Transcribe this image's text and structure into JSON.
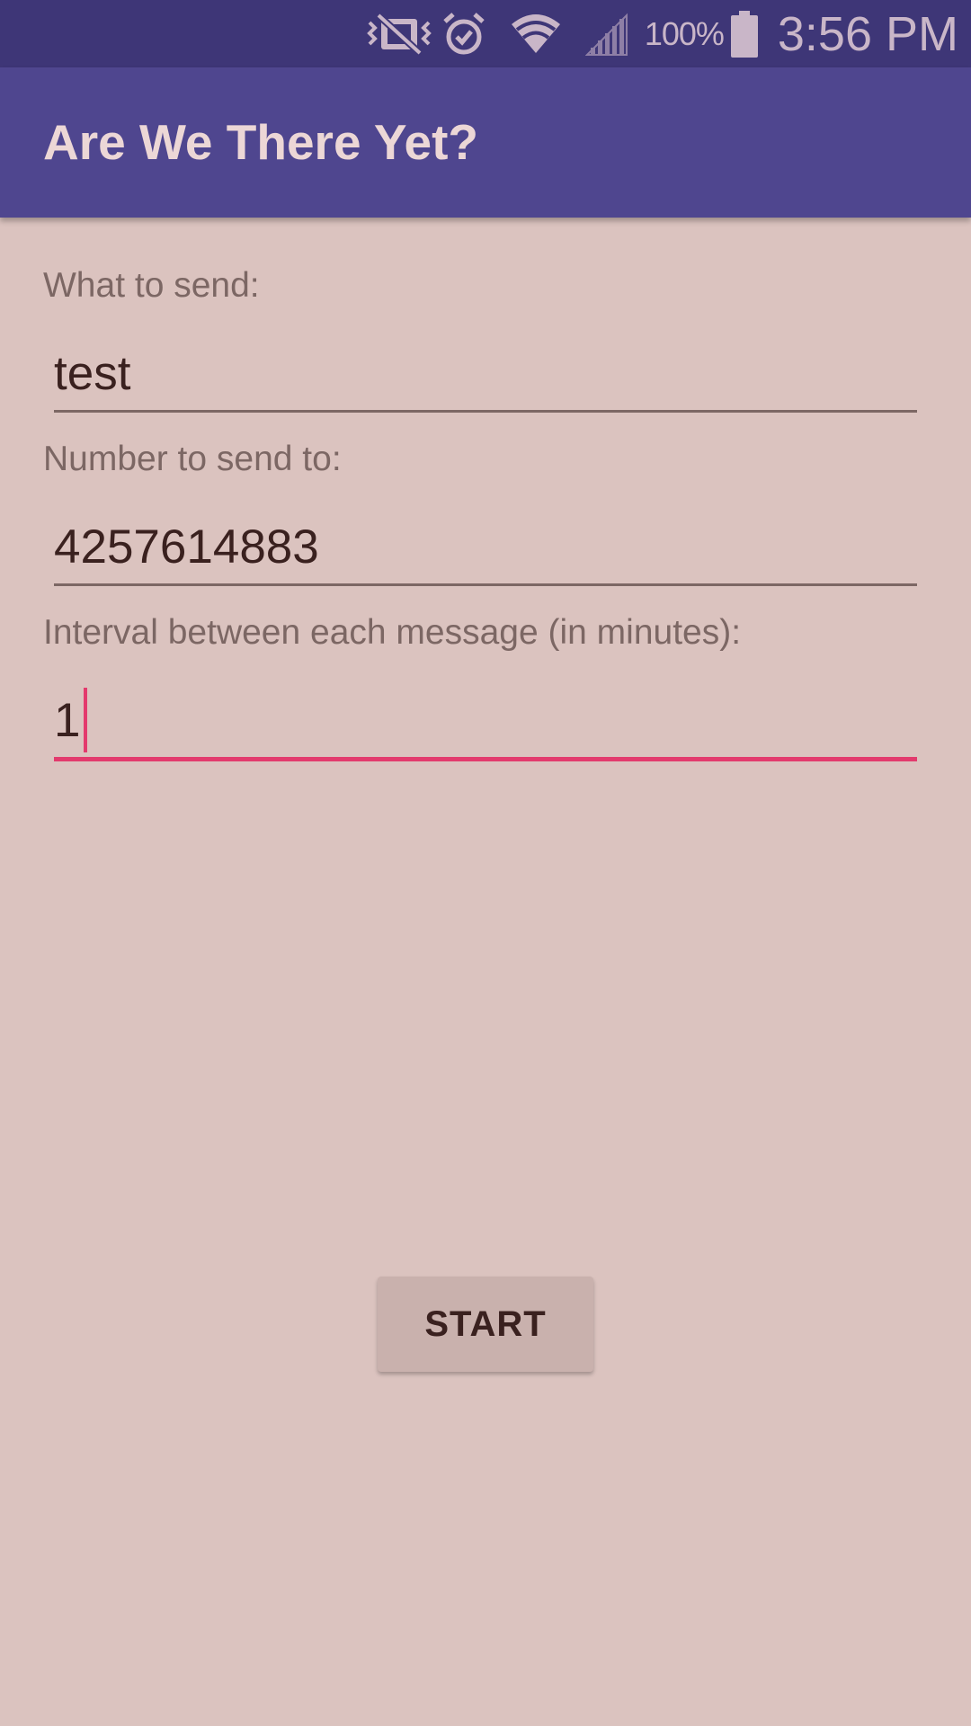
{
  "status_bar": {
    "icons": [
      "vibrate-icon",
      "alarm-icon",
      "wifi-icon",
      "signal-icon",
      "battery-icon"
    ],
    "battery_percent": "100%",
    "time": "3:56 PM"
  },
  "app_bar": {
    "title": "Are We There Yet?"
  },
  "form": {
    "message": {
      "label": "What to send:",
      "value": "test"
    },
    "phone": {
      "label": "Number to send to:",
      "value": "4257614883"
    },
    "interval": {
      "label": "Interval between each message (in minutes):",
      "value": "1"
    }
  },
  "actions": {
    "start_label": "START"
  },
  "colors": {
    "status_bar": "#3e3677",
    "app_bar": "#4f468f",
    "background": "#dbc3bf",
    "accent": "#e33a6d",
    "button": "#c9b1ad"
  }
}
